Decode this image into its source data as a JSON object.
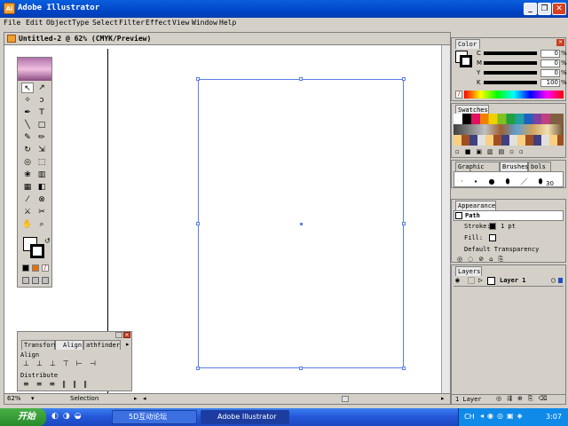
{
  "window": {
    "title": "Adobe Illustrator",
    "app_icon": "Ai"
  },
  "menu": [
    "File",
    "Edit",
    "Object",
    "Type",
    "Select",
    "Filter",
    "Effect",
    "View",
    "Window",
    "Help"
  ],
  "document": {
    "title": "Untitled-2 @ 62% (CMYK/Preview)",
    "zoom": "62%",
    "status": "Selection"
  },
  "color_panel": {
    "tab": "Color",
    "channels": [
      {
        "label": "C",
        "value": "0",
        "unit": "%"
      },
      {
        "label": "M",
        "value": "0",
        "unit": "%"
      },
      {
        "label": "Y",
        "value": "0",
        "unit": "%"
      },
      {
        "label": "K",
        "value": "100",
        "unit": "%"
      }
    ]
  },
  "swatches_panel": {
    "tab": "Swatches"
  },
  "brushes_panel": {
    "tabs": [
      "Graphic Styl",
      "Brushes",
      "bols"
    ],
    "brush_size": "30"
  },
  "appearance_panel": {
    "tab": "Appearance",
    "object": "Path",
    "stroke_label": "Stroke:",
    "stroke_value": "1 pt",
    "fill_label": "Fill:",
    "transparency": "Default Transparency"
  },
  "layers_panel": {
    "tab": "Layers",
    "layer_name": "Layer 1",
    "footer": "1 Layer"
  },
  "align_panel": {
    "tabs": [
      "Transform",
      "Align",
      "athfinder"
    ],
    "align_label": "Align",
    "distribute_label": "Distribute"
  },
  "taskbar": {
    "start": "开始",
    "tasks": [
      "5D互动论坛",
      "Adobe Illustrator"
    ],
    "ime": "CH",
    "clock": "3:07"
  },
  "colors": {
    "titlebar": "#0046c8",
    "artboard": "#5a7ee8",
    "taskbar": "#2456d8"
  }
}
